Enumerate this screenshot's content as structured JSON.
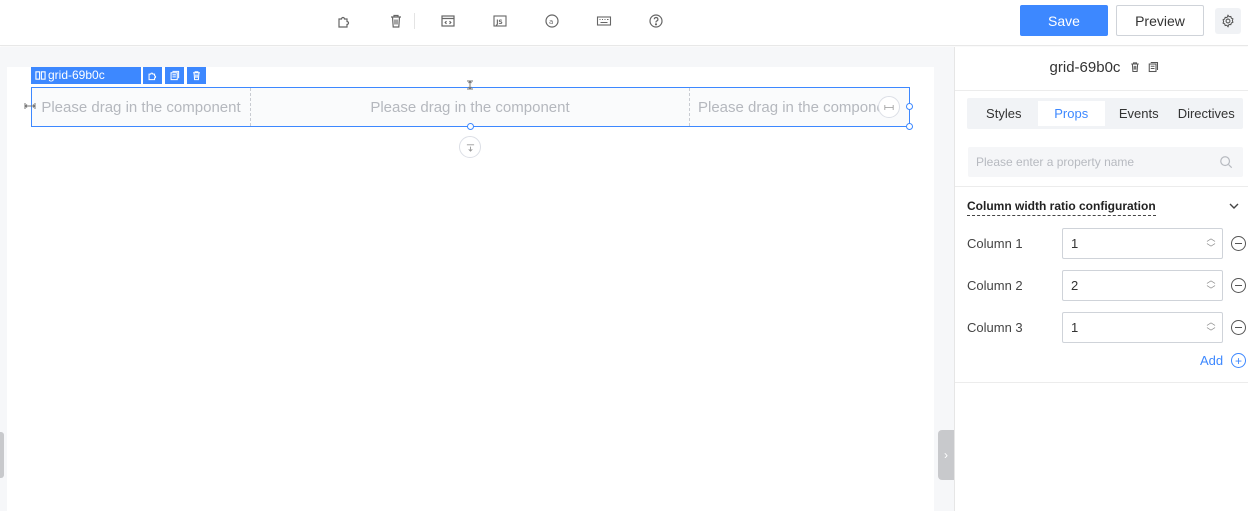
{
  "toolbar": {
    "icons": [
      "component-icon",
      "delete-icon",
      "code-icon",
      "js-icon",
      "at-icon",
      "keyboard-icon",
      "help-icon"
    ],
    "save_label": "Save",
    "preview_label": "Preview",
    "accent_color": "#3d88ff"
  },
  "canvas": {
    "component_label": "grid-69b0c",
    "columns": [
      {
        "placeholder": "Please drag in the component"
      },
      {
        "placeholder": "Please drag in the component"
      },
      {
        "placeholder": "Please drag in the component"
      }
    ]
  },
  "panel": {
    "title": "grid-69b0c",
    "tabs": [
      {
        "label": "Styles",
        "active": false
      },
      {
        "label": "Props",
        "active": true
      },
      {
        "label": "Events",
        "active": false
      },
      {
        "label": "Directives",
        "active": false
      }
    ],
    "search_placeholder": "Please enter a property name",
    "section_title": "Column width ratio configuration",
    "rows": [
      {
        "label": "Column 1",
        "value": "1"
      },
      {
        "label": "Column 2",
        "value": "2"
      },
      {
        "label": "Column 3",
        "value": "1"
      }
    ],
    "add_label": "Add"
  }
}
